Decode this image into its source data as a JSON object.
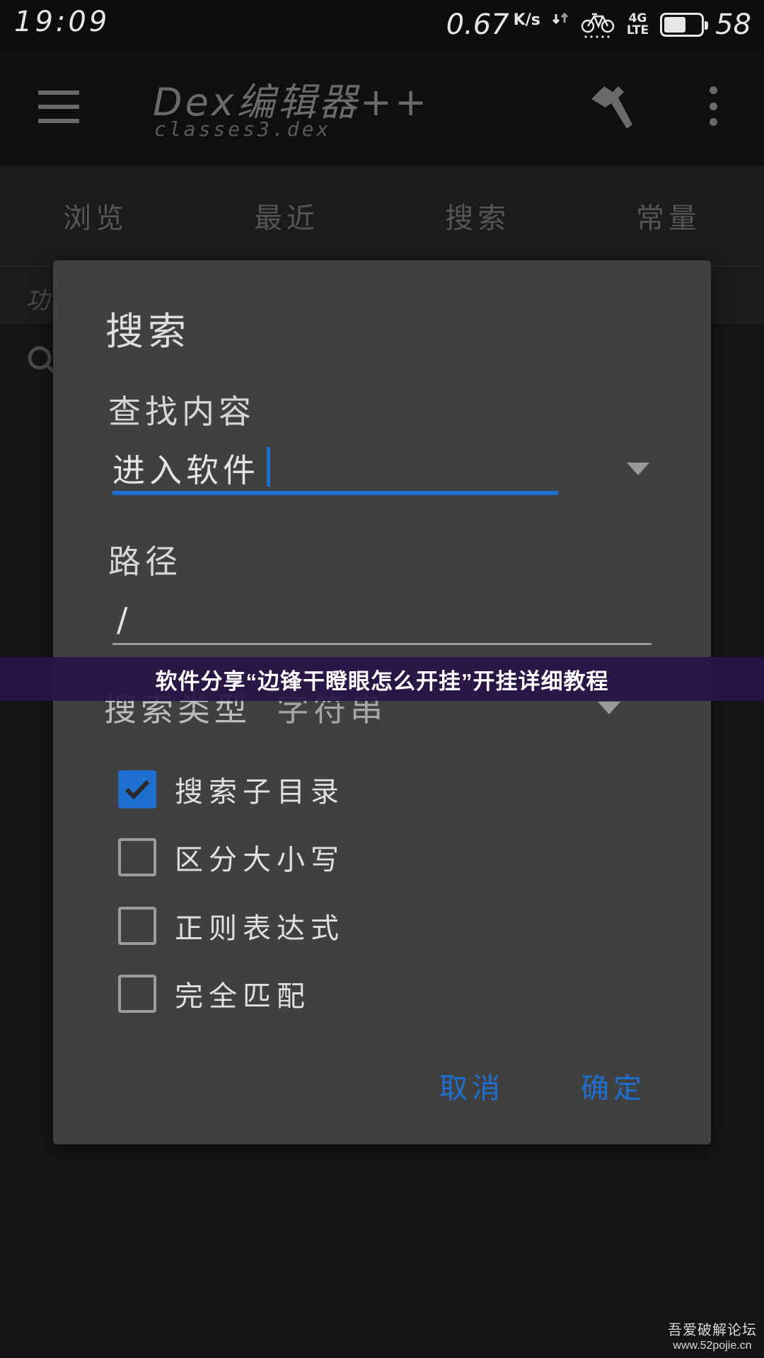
{
  "status_bar": {
    "time": "19:09",
    "net_speed": "0.67",
    "net_speed_unit": "K/s",
    "network_type_top": "4G",
    "network_type_bottom": "LTE",
    "battery_level": "58",
    "battery_fraction": 0.6,
    "icons": [
      "updown-arrows-icon",
      "bike-icon",
      "battery-icon"
    ]
  },
  "app_bar": {
    "title": "Dex编辑器++",
    "subtitle": "classes3.dex",
    "icons": [
      "menu-icon",
      "hammer-icon",
      "more-vert-icon"
    ]
  },
  "tabs": [
    {
      "label": "浏览"
    },
    {
      "label": "最近"
    },
    {
      "label": "搜索"
    },
    {
      "label": "常量"
    }
  ],
  "sub_bar": {
    "text": "功"
  },
  "dialog": {
    "title": "搜索",
    "find_label": "查找内容",
    "find_value": "进入软件",
    "path_label": "路径",
    "path_value": "/",
    "search_type_label": "搜索类型",
    "search_type_value": "字符串",
    "options": [
      {
        "label": "搜索子目录",
        "checked": true
      },
      {
        "label": "区分大小写",
        "checked": false
      },
      {
        "label": "正则表达式",
        "checked": false
      },
      {
        "label": "完全匹配",
        "checked": false
      }
    ],
    "cancel_label": "取消",
    "confirm_label": "确定"
  },
  "banner": {
    "text": "软件分享“边锋干瞪眼怎么开挂”开挂详细教程"
  },
  "watermark": {
    "line1": "吾爱破解论坛",
    "line2": "www.52pojie.cn"
  },
  "colors": {
    "accent": "#1f6fd1",
    "dialog_bg": "#404040",
    "banner_bg": "#28144a"
  }
}
